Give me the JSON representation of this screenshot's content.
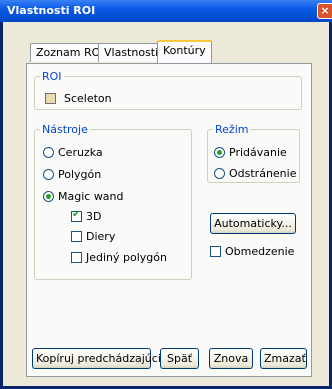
{
  "window": {
    "title": "Vlastnosti ROI",
    "close": "×"
  },
  "tabs": [
    "Zoznam ROI",
    "Vlastnosti",
    "Kontúry"
  ],
  "roi": {
    "legend": "ROI",
    "name": "Sceleton",
    "swatch_color": "#e8dcb0"
  },
  "tools": {
    "legend": "Nástroje",
    "options": [
      "Ceruzka",
      "Polygón",
      "Magic wand"
    ],
    "selected": "Magic wand",
    "sub": [
      {
        "label": "3D",
        "checked": true
      },
      {
        "label": "Diery",
        "checked": false
      },
      {
        "label": "Jediný polygón",
        "checked": false
      }
    ]
  },
  "mode": {
    "legend": "Režim",
    "options": [
      "Pridávanie",
      "Odstránenie"
    ],
    "selected": "Pridávanie"
  },
  "auto_button": "Automaticky...",
  "limit": {
    "label": "Obmedzenie",
    "checked": false
  },
  "buttons": {
    "copy_prev": "Kopíruj predchádzajúci",
    "back": "Späť",
    "again": "Znova",
    "delete": "Zmazať"
  }
}
